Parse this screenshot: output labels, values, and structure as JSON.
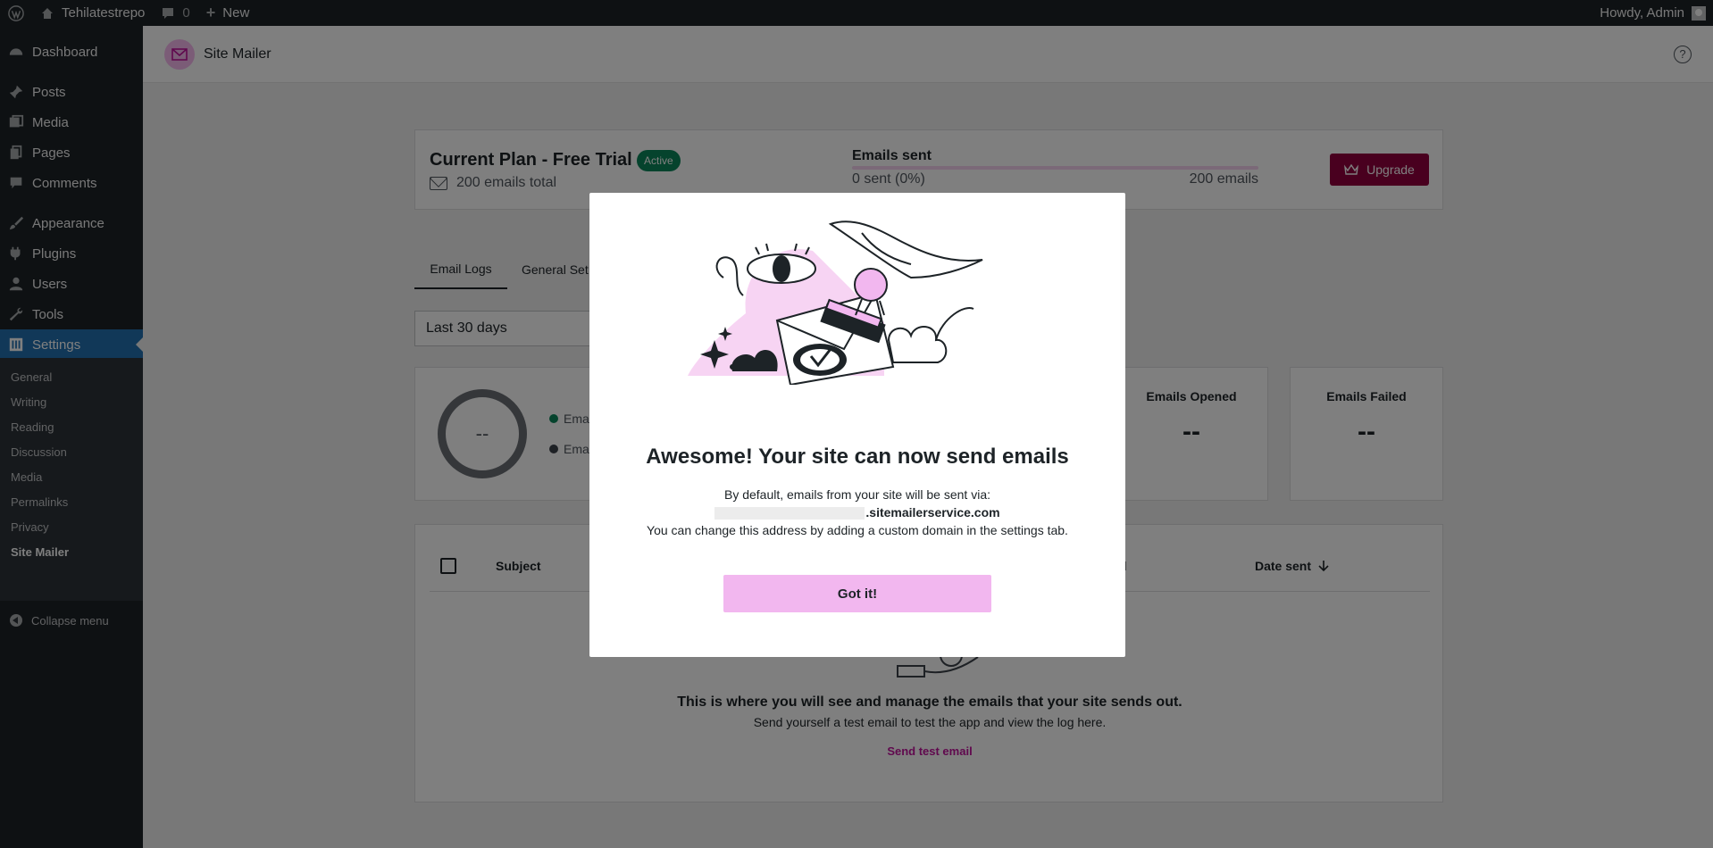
{
  "adminbar": {
    "site_name": "Tehilatestrepo",
    "comments_count": "0",
    "new_label": "New",
    "howdy": "Howdy, Admin"
  },
  "sidebar": {
    "items": [
      {
        "label": "Dashboard",
        "icon": "dashboard-icon"
      },
      {
        "label": "Posts",
        "icon": "pin-icon"
      },
      {
        "label": "Media",
        "icon": "media-icon"
      },
      {
        "label": "Pages",
        "icon": "pages-icon"
      },
      {
        "label": "Comments",
        "icon": "comment-icon"
      },
      {
        "label": "Appearance",
        "icon": "brush-icon"
      },
      {
        "label": "Plugins",
        "icon": "plug-icon"
      },
      {
        "label": "Users",
        "icon": "user-icon"
      },
      {
        "label": "Tools",
        "icon": "wrench-icon"
      },
      {
        "label": "Settings",
        "icon": "settings-icon"
      }
    ],
    "submenu": [
      "General",
      "Writing",
      "Reading",
      "Discussion",
      "Media",
      "Permalinks",
      "Privacy",
      "Site Mailer"
    ],
    "collapse_label": "Collapse menu"
  },
  "plugin_header": {
    "title": "Site Mailer",
    "help": "?"
  },
  "plan": {
    "title": "Current Plan - Free Trial",
    "badge": "Active",
    "total": "200 emails total",
    "sent_label": "Emails sent",
    "sent_value": "0 sent (0%)",
    "sent_max": "200 emails",
    "progress_fraction": 0,
    "upgrade": "Upgrade"
  },
  "tabs": [
    "Email Logs",
    "General Set"
  ],
  "date_filter": "Last 30 days",
  "stats": {
    "donut_value": "--",
    "legend": [
      {
        "label": "Emai",
        "color": "#0a875a"
      },
      {
        "label": "Emai",
        "color": "#3c434a"
      }
    ],
    "cards": [
      {
        "label": "Emails Opened",
        "value": "--"
      },
      {
        "label": "Emails Failed",
        "value": "--"
      }
    ]
  },
  "table": {
    "headers": [
      "Subject",
      "d",
      "Date sent"
    ],
    "sort_icon": "arrow-down-icon",
    "empty_title": "This is where you will see and manage the emails that your site sends out.",
    "empty_sub": "Send yourself a test email to test the app and view the log here.",
    "send_test": "Send test email"
  },
  "modal": {
    "title": "Awesome! Your site can now send emails",
    "line1": "By default, emails from your site will be sent via:",
    "domain": ".sitemailerservice.com",
    "line3": "You can change this address by adding a custom domain in the settings tab.",
    "button": "Got it!"
  },
  "colors": {
    "accent": "#c1129c",
    "upgrade": "#93003f",
    "active_badge": "#0a875a",
    "button_pink": "#f2b7ef",
    "wp_blue": "#2271b1"
  }
}
